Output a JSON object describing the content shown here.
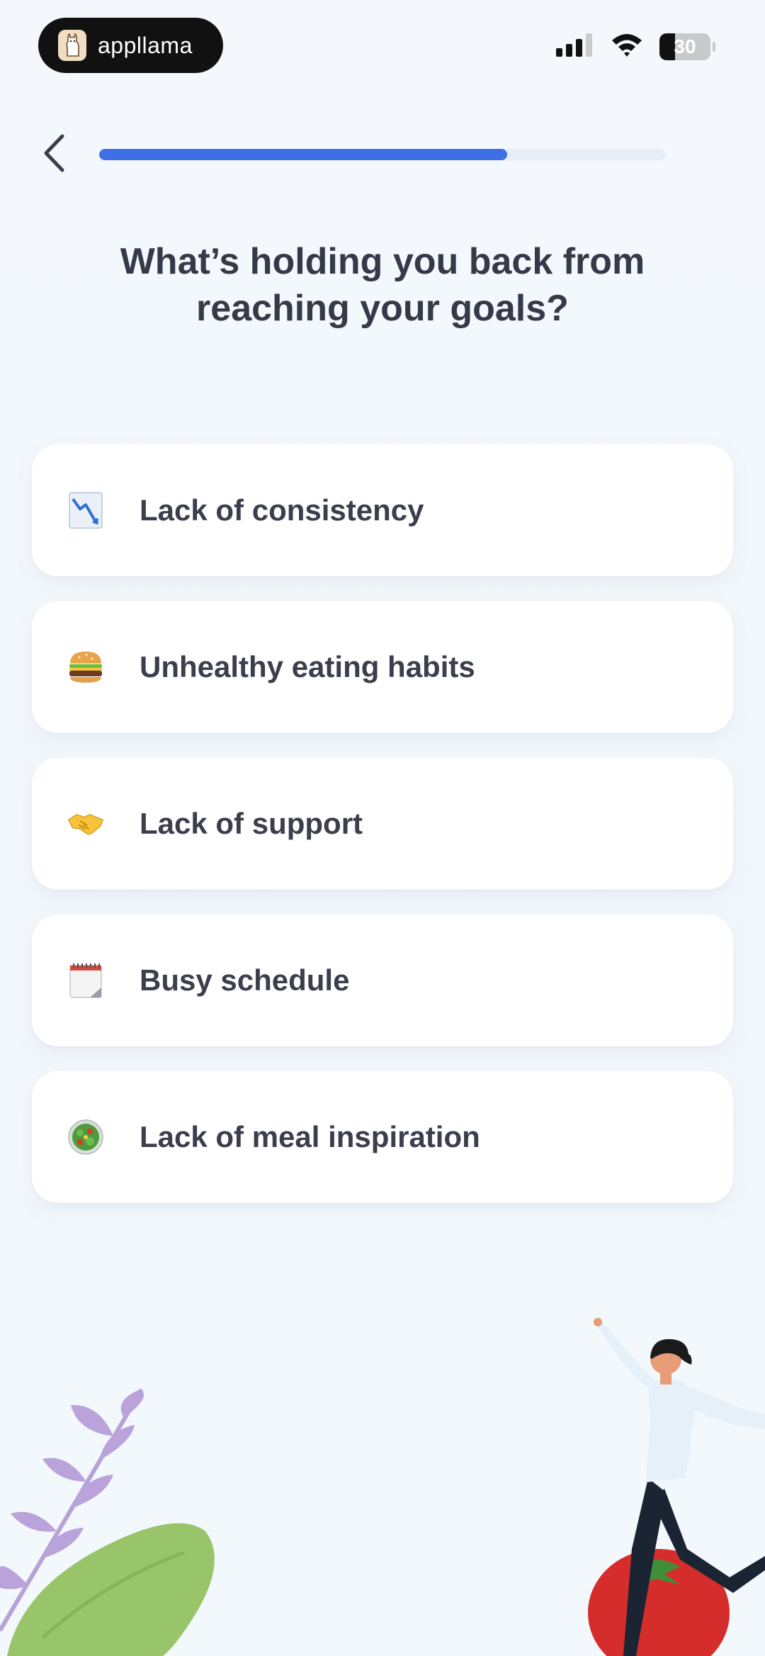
{
  "status_bar": {
    "brand_name": "appllama",
    "battery": "30",
    "battery_level": 0.3
  },
  "header": {
    "back_icon": "chevron-left-icon",
    "progress": 0.72,
    "progress_color": "#3f6fe4"
  },
  "question": {
    "title": "What’s holding you back from reaching your goals?"
  },
  "options": [
    {
      "label": "Lack of consistency",
      "icon": "chart-decreasing-icon"
    },
    {
      "label": "Unhealthy eating habits",
      "icon": "hamburger-icon"
    },
    {
      "label": "Lack of support",
      "icon": "handshake-icon"
    },
    {
      "label": "Busy schedule",
      "icon": "calendar-icon"
    },
    {
      "label": "Lack of meal inspiration",
      "icon": "salad-icon"
    }
  ],
  "colors": {
    "background": "#f3f7fb",
    "card": "#ffffff",
    "text": "#3b3e4c",
    "accent": "#3f6fe4"
  }
}
